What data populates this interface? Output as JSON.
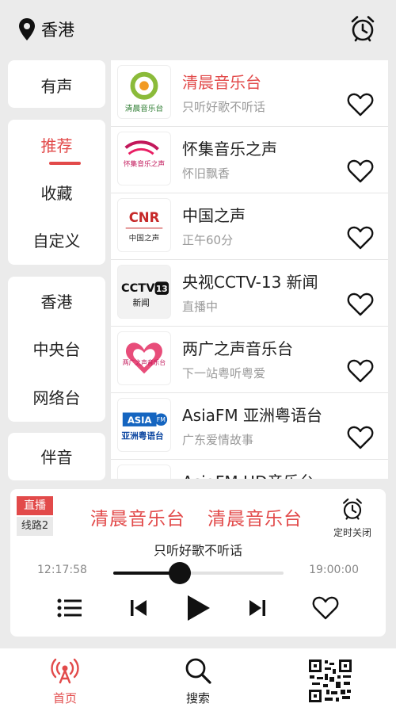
{
  "header": {
    "location": "香港",
    "location_icon": "location-pin-icon",
    "alarm_icon": "alarm-clock-icon"
  },
  "menu": {
    "group1": [
      "有声"
    ],
    "group2": [
      "推荐",
      "收藏",
      "自定义"
    ],
    "group3": [
      "香港",
      "中央台",
      "网络台"
    ],
    "group4": [
      "伴音"
    ],
    "active": "推荐"
  },
  "stations": [
    {
      "name": "清晨音乐台",
      "sub": "只听好歌不听话",
      "logo_text": "清晨音乐台",
      "active": true
    },
    {
      "name": "怀集音乐之声",
      "sub": "怀旧飘香",
      "logo_text": "怀集音乐之声"
    },
    {
      "name": "中国之声",
      "sub": "正午60分",
      "logo_text": "CNR",
      "logo_sub": "中国之声"
    },
    {
      "name": "央视CCTV-13 新闻",
      "sub": "直播中",
      "logo_text": "CCTV",
      "logo_num": "13",
      "logo_sub": "新闻"
    },
    {
      "name": "两广之声音乐台",
      "sub": "下一站粤听粤爱",
      "logo_text": "两广之声音乐台"
    },
    {
      "name": "AsiaFM 亚洲粤语台",
      "sub": "广东爱情故事",
      "logo_text": "ASIA",
      "logo_fm": "FM",
      "logo_sub": "亚洲粤语台"
    },
    {
      "name": "AsiaFM HD音乐台",
      "sub": ""
    }
  ],
  "player": {
    "live_badge": "直播",
    "route_badge": "线路2",
    "title": [
      "清晨音乐台",
      "清晨音乐台"
    ],
    "subtitle": "只听好歌不听话",
    "time_start": "12:17:58",
    "time_end": "19:00:00",
    "progress": 0.39,
    "timer_label": "定时关闭"
  },
  "nav": {
    "home": "首页",
    "search": "搜索",
    "qr_icon": "qr-code-icon"
  },
  "colors": {
    "accent": "#e24a4a",
    "background": "#ebebeb"
  }
}
